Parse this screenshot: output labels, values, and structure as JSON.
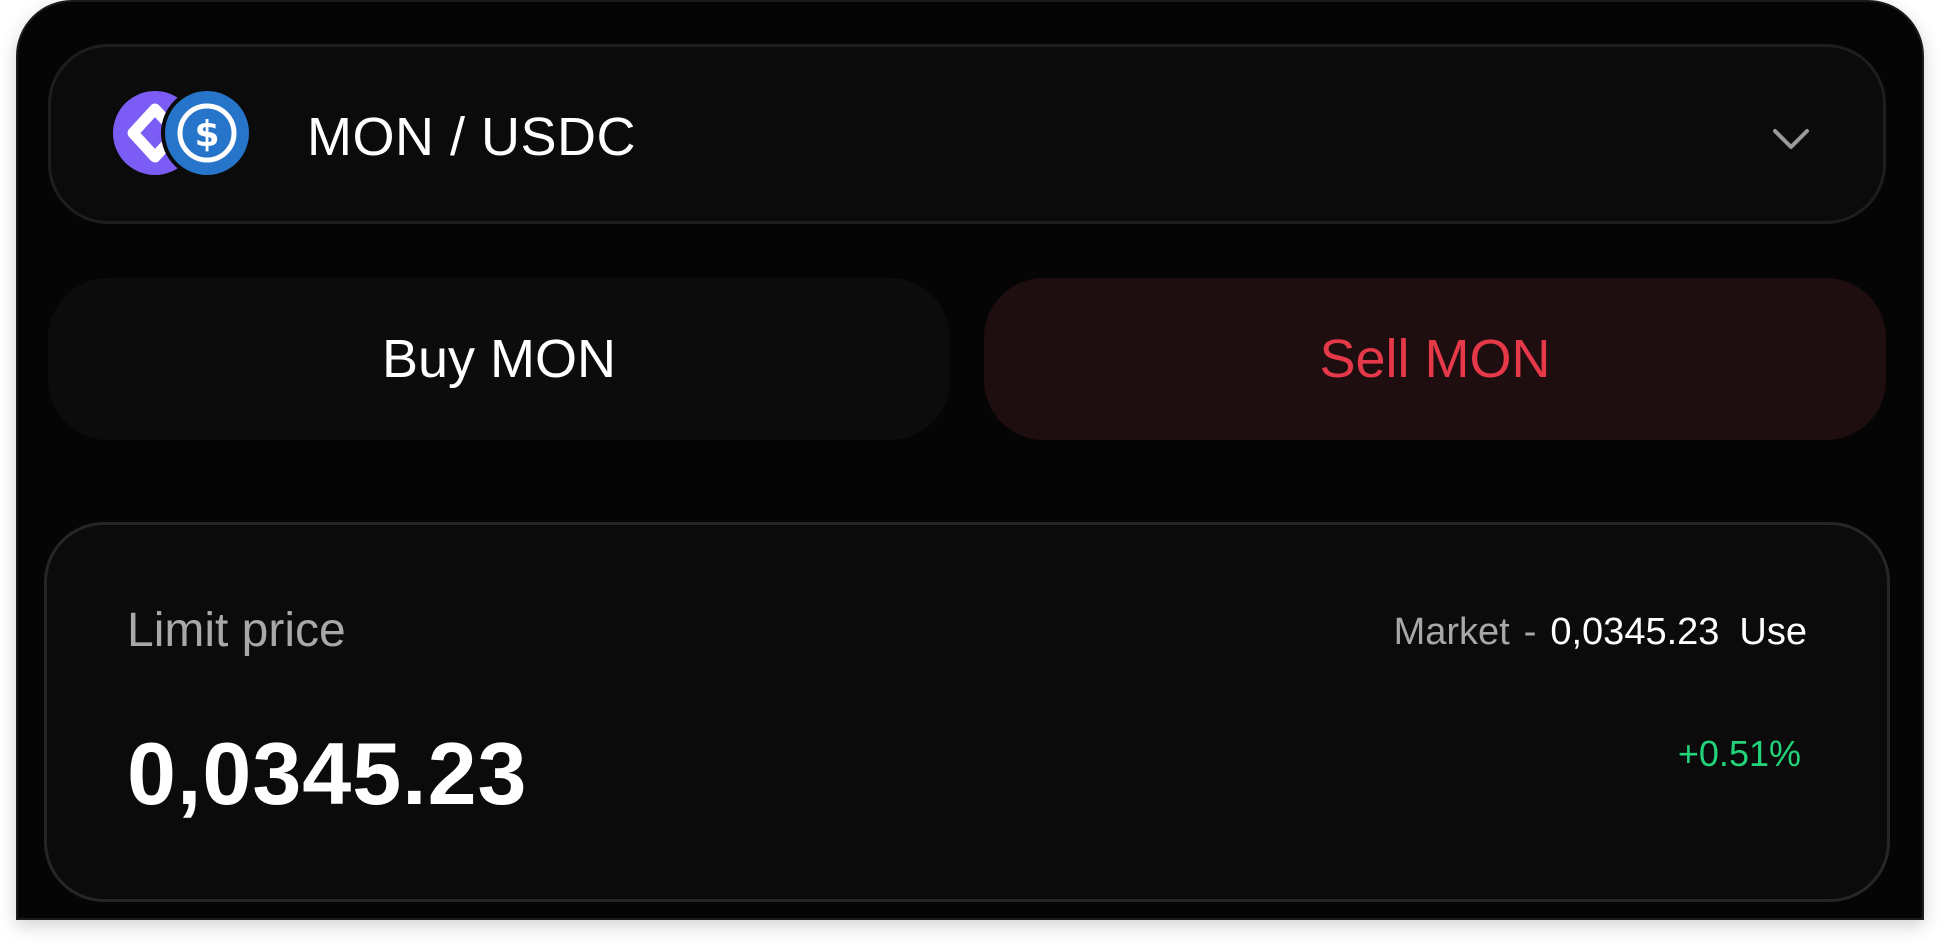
{
  "pair_selector": {
    "label": "MON / USDC",
    "base_token_icon": "monad-icon",
    "quote_token_icon": "usdc-icon",
    "chevron_icon": "chevron-down-icon"
  },
  "side_tabs": {
    "buy_label": "Buy MON",
    "sell_label": "Sell MON",
    "selected": "sell"
  },
  "limit_price": {
    "label": "Limit price",
    "market_label": "Market",
    "market_separator": "-",
    "market_value": "0,0345.23",
    "use_label": "Use",
    "value": "0,0345.23",
    "change": "+0.51%"
  },
  "colors": {
    "background": "#050505",
    "sell_accent": "#e53848",
    "sell_bg": "#1e0e10",
    "positive": "#22d37a",
    "base_token": "#7b5cf5",
    "quote_token": "#2775ca"
  }
}
